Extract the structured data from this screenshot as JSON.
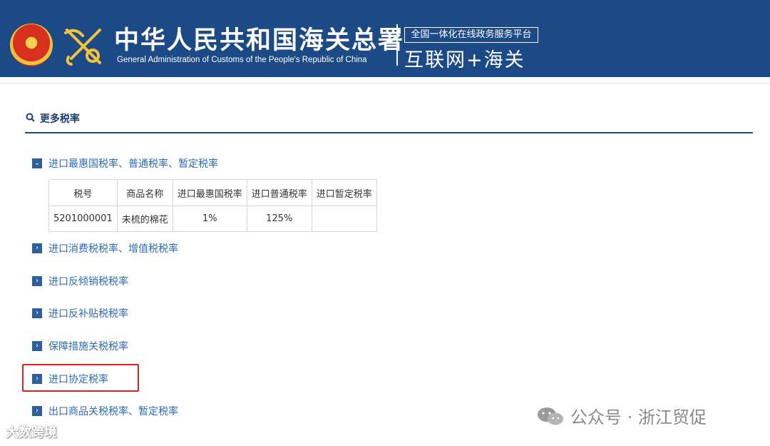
{
  "header": {
    "title_cn": "中华人民共和国海关总署",
    "title_en": "General Administration of Customs of the People's Republic of China",
    "platform_box": "全国一体化在线政务服务平台",
    "platform_title": "互联网+海关"
  },
  "section": {
    "heading": "更多税率",
    "icon": "search-icon"
  },
  "categories": [
    {
      "label": "进口最惠国税率、普通税率、暂定税率",
      "state": "expanded",
      "marker": "⌄"
    },
    {
      "label": "进口消费税税率、增值税税率",
      "state": "collapsed",
      "marker": "›"
    },
    {
      "label": "进口反倾销税税率",
      "state": "collapsed",
      "marker": "›"
    },
    {
      "label": "进口反补贴税税率",
      "state": "collapsed",
      "marker": "›"
    },
    {
      "label": "保障措施关税税率",
      "state": "collapsed",
      "marker": "›"
    },
    {
      "label": "进口协定税率",
      "state": "collapsed",
      "marker": "›"
    },
    {
      "label": "出口商品关税税率、暂定税率",
      "state": "collapsed",
      "marker": "›"
    }
  ],
  "rate_table": {
    "headers": [
      "税号",
      "商品名称",
      "进口最惠国税率",
      "进口普通税率",
      "进口暂定税率"
    ],
    "rows": [
      [
        "5201000001",
        "未梳的棉花",
        "1%",
        "125%",
        ""
      ]
    ]
  },
  "watermarks": {
    "left": "大数跨境",
    "right": "公众号 · 浙江贸促"
  },
  "colors": {
    "header_bg": "#1c4a86",
    "link": "#2d6bb3",
    "highlight": "#e0211f"
  }
}
